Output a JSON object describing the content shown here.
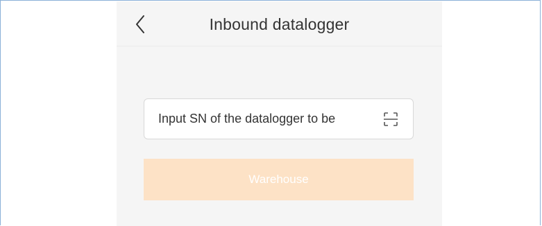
{
  "header": {
    "title": "Inbound datalogger",
    "back_icon": "chevron-left-icon"
  },
  "form": {
    "sn_placeholder": "Input SN of the datalogger to be",
    "sn_value": "",
    "scan_icon": "scan-icon"
  },
  "actions": {
    "warehouse_label": "Warehouse",
    "warehouse_color": "#fde2c6",
    "warehouse_text_color": "#ffffff"
  }
}
